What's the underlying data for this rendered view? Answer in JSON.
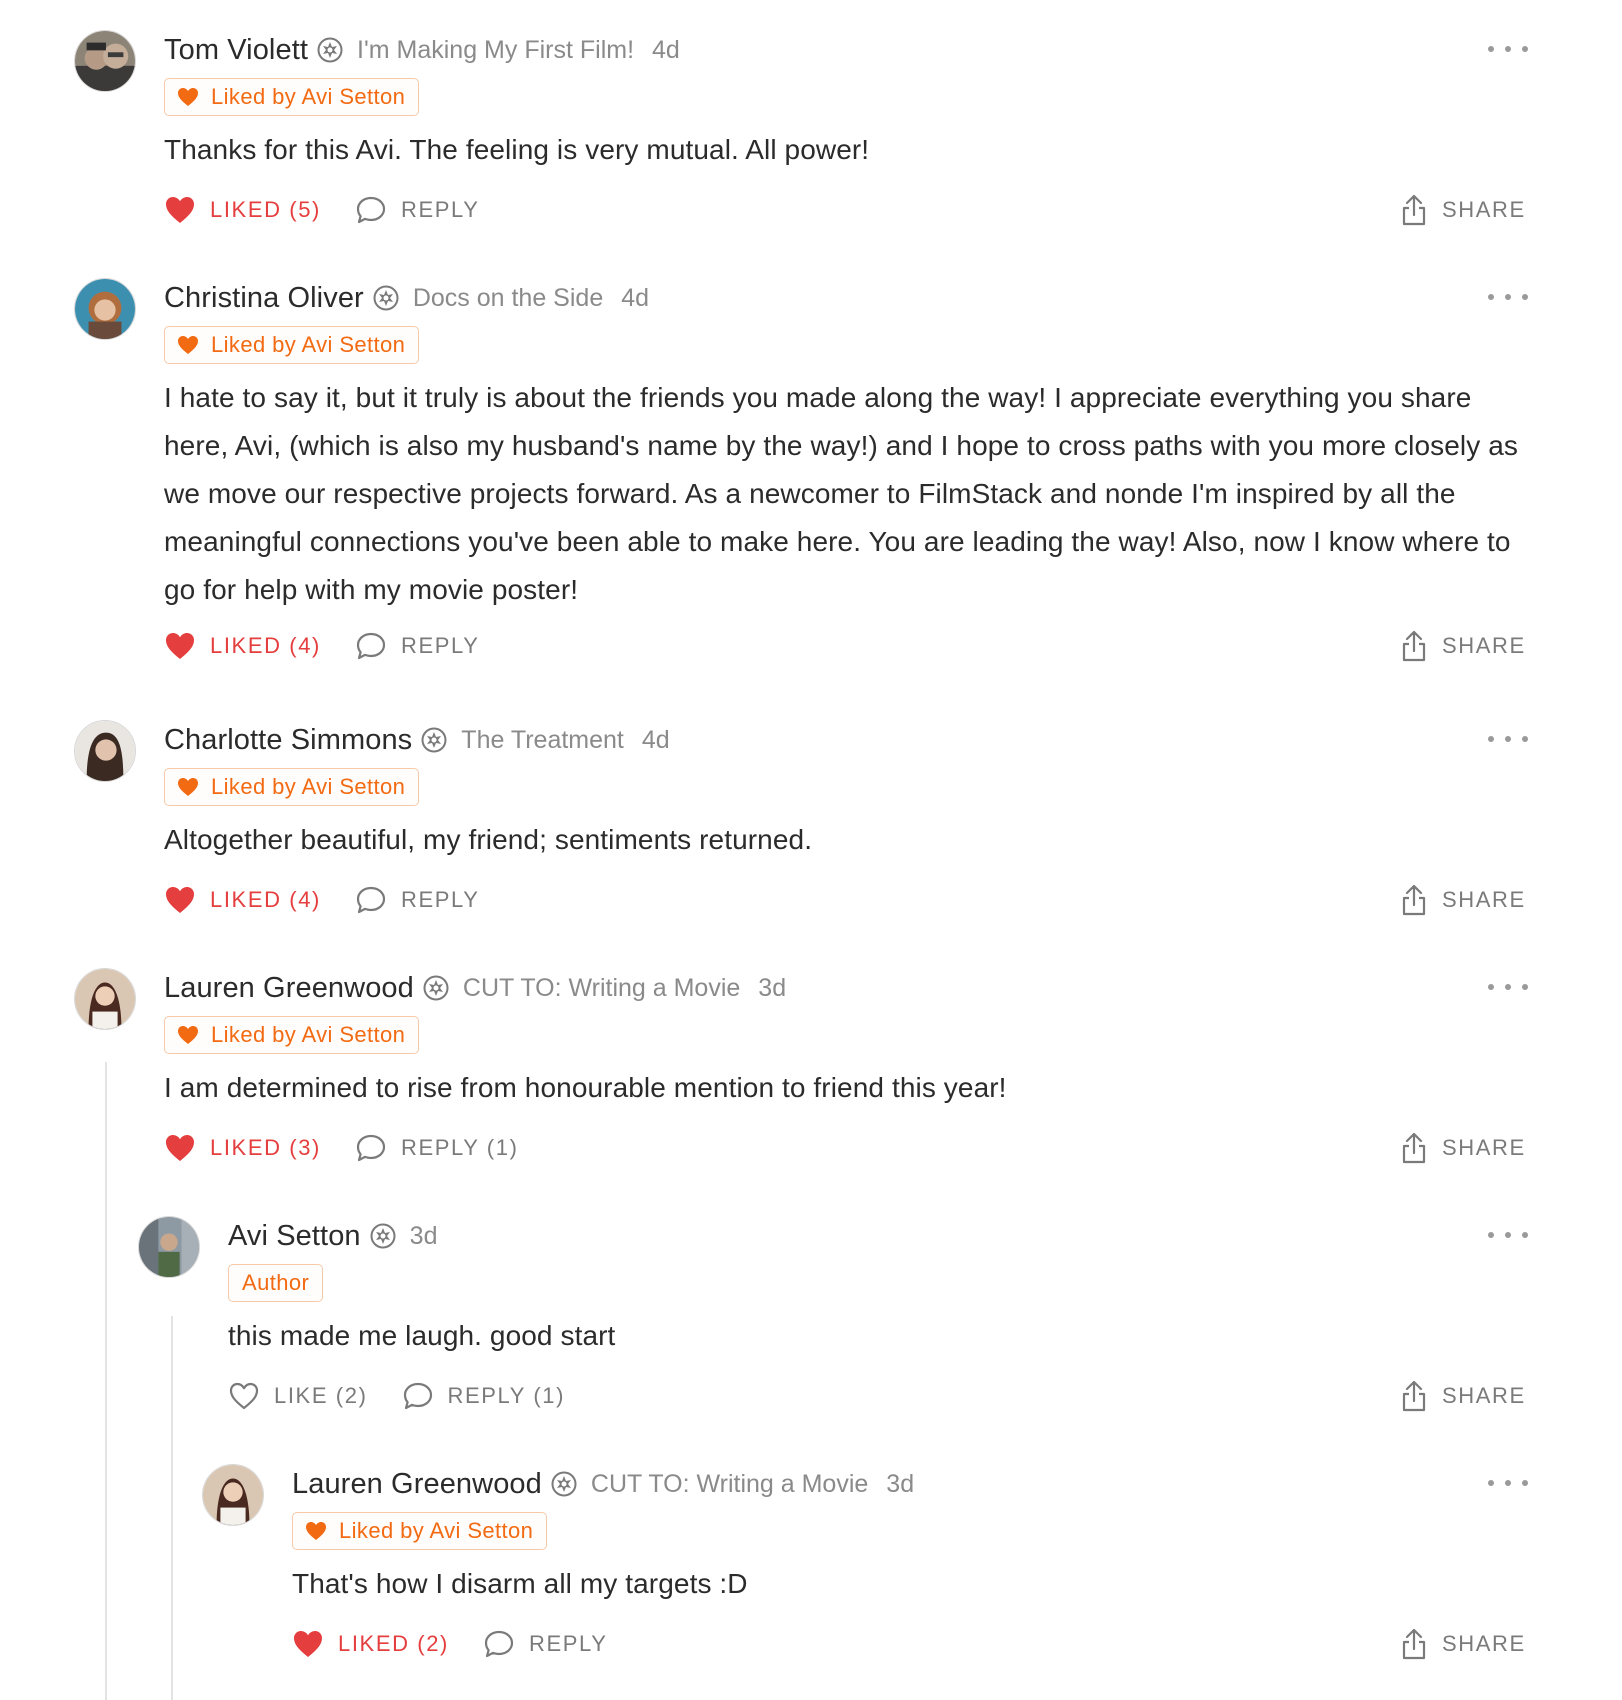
{
  "colors": {
    "accent_orange": "#f26a12",
    "liked_red": "#e53e3e",
    "muted_text": "#8a8a8a"
  },
  "icons": {
    "badge": "subscriber-badge-icon",
    "more": "more-options-icon",
    "like_filled": "heart-filled-icon",
    "like_outline": "heart-outline-icon",
    "reply": "speech-bubble-icon",
    "share": "share-upload-icon"
  },
  "comments": [
    {
      "author": "Tom Violett",
      "publication": "I'm Making My First Film!",
      "time": "4d",
      "chip": "Liked by Avi Setton",
      "body": "Thanks for this Avi. The feeling is very mutual. All power!",
      "like_label": "LIKED (5)",
      "liked": true,
      "reply_label": "REPLY",
      "share_label": "SHARE"
    },
    {
      "author": "Christina Oliver",
      "publication": "Docs on the Side",
      "time": "4d",
      "chip": "Liked by Avi Setton",
      "body": "I hate to say it, but it truly is about the friends you made along the way! I appreciate everything you share here, Avi, (which is also my husband's name by the way!) and I hope to cross paths with you more closely as we move our respective projects forward. As a newcomer to FilmStack and nonde I'm inspired by all the meaningful connections you've been able to make here. You are leading the way! Also, now I know where to go for help with my movie poster!",
      "like_label": "LIKED (4)",
      "liked": true,
      "reply_label": "REPLY",
      "share_label": "SHARE"
    },
    {
      "author": "Charlotte Simmons",
      "publication": "The Treatment",
      "time": "4d",
      "chip": "Liked by Avi Setton",
      "body": "Altogether beautiful, my friend; sentiments returned.",
      "like_label": "LIKED (4)",
      "liked": true,
      "reply_label": "REPLY",
      "share_label": "SHARE"
    },
    {
      "author": "Lauren Greenwood",
      "publication": "CUT TO: Writing a Movie",
      "time": "3d",
      "chip": "Liked by Avi Setton",
      "body": "I am determined to rise from honourable mention to friend this year!",
      "like_label": "LIKED (3)",
      "liked": true,
      "reply_label": "REPLY (1)",
      "share_label": "SHARE"
    },
    {
      "author": "Avi Setton",
      "publication": "",
      "time": "3d",
      "chip": "Author",
      "body": "this made me laugh. good start",
      "like_label": "LIKE (2)",
      "liked": false,
      "reply_label": "REPLY (1)",
      "share_label": "SHARE"
    },
    {
      "author": "Lauren Greenwood",
      "publication": "CUT TO: Writing a Movie",
      "time": "3d",
      "chip": "Liked by Avi Setton",
      "body": "That's how I disarm all my targets :D",
      "like_label": "LIKED (2)",
      "liked": true,
      "reply_label": "REPLY",
      "share_label": "SHARE"
    }
  ]
}
